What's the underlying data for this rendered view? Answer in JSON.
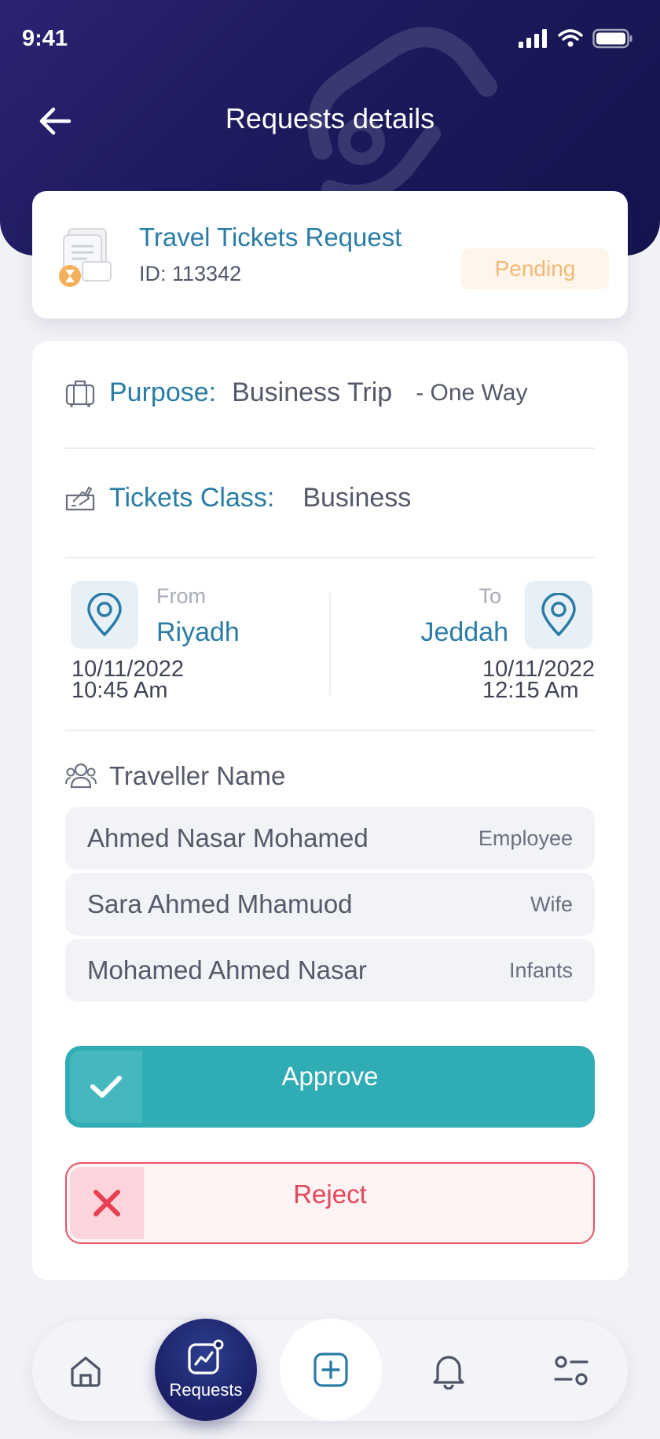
{
  "status_bar": {
    "time": "9:41"
  },
  "header": {
    "title": "Requests details"
  },
  "request": {
    "title": "Travel Tickets Request",
    "id_text": "ID: 113342",
    "status": "Pending"
  },
  "details": {
    "purpose_label": "Purpose:",
    "purpose_value": "Business Trip",
    "trip_type": "- One Way",
    "class_label": "Tickets Class:",
    "class_value": "Business"
  },
  "route": {
    "from_label": "From",
    "from_city": "Riyadh",
    "from_date": "10/11/2022",
    "from_time": "10:45 Am",
    "to_label": "To",
    "to_city": "Jeddah",
    "to_date": "10/11/2022",
    "to_time": "12:15 Am"
  },
  "travellers": {
    "heading": "Traveller Name",
    "items": [
      {
        "name": "Ahmed Nasar Mohamed",
        "role": "Employee"
      },
      {
        "name": "Sara Ahmed Mhamuod",
        "role": "Wife"
      },
      {
        "name": "Mohamed Ahmed Nasar",
        "role": "Infants"
      }
    ]
  },
  "actions": {
    "approve": "Approve",
    "reject": "Reject"
  },
  "bottom_nav": {
    "active_label": "Requests"
  },
  "colors": {
    "accent_blue": "#2a7ca6",
    "header_bg": "#1c1a5c",
    "approve": "#30acb4",
    "reject": "#ea5266",
    "pending": "#f2b977"
  }
}
